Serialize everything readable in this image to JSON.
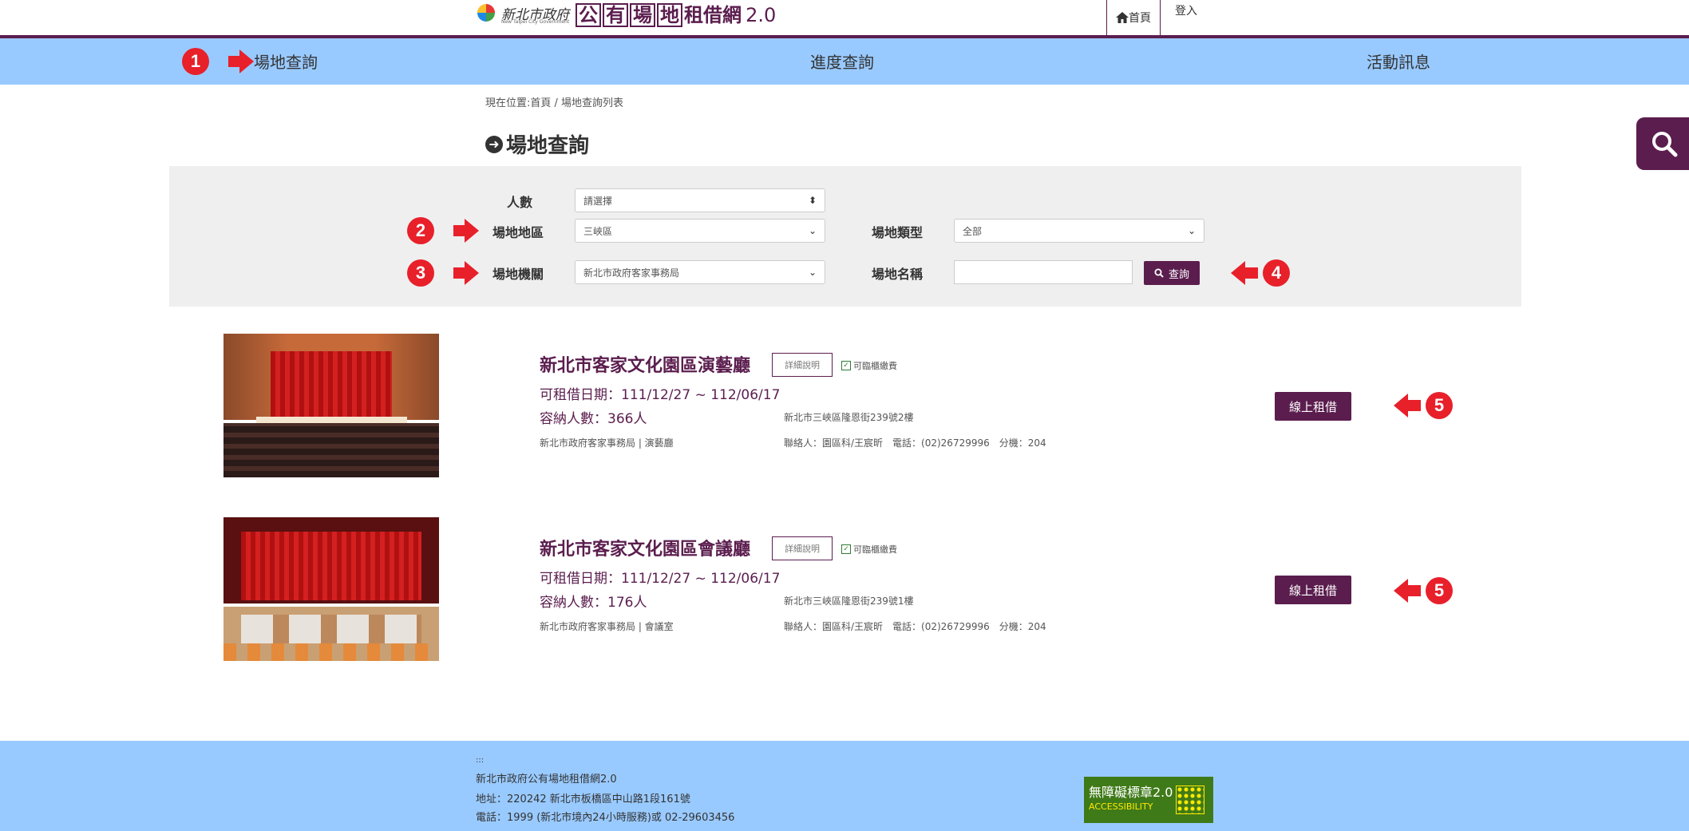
{
  "header": {
    "logo_gov": "新北市政府",
    "logo_gov_en": "New Taipei City Government",
    "logo_box_chars": [
      "公",
      "有",
      "場",
      "地"
    ],
    "logo_rest": "租借網",
    "logo_version": "2.0",
    "home_label": "首頁",
    "login_label": "登入"
  },
  "nav": {
    "items": [
      "場地查詢",
      "進度查詢",
      "活動訊息"
    ]
  },
  "breadcrumb": "現在位置:首頁 / 場地查詢列表",
  "page_title": "場地查詢",
  "search_form": {
    "people_label": "人數",
    "people_value": "請選擇",
    "area_label": "場地地區",
    "area_value": "三峽區",
    "type_label": "場地類型",
    "type_value": "全部",
    "agency_label": "場地機關",
    "agency_value": "新北市政府客家事務局",
    "name_label": "場地名稱",
    "name_value": "",
    "search_label": "查詢"
  },
  "markers": [
    "1",
    "2",
    "3",
    "4",
    "5"
  ],
  "results": [
    {
      "title": "新北市客家文化園區演藝廳",
      "detail_label": "詳細說明",
      "approve_label": "可臨櫃繳費",
      "date": "可租借日期：111/12/27 ~ 112/06/17",
      "capacity": "容納人數：366人",
      "address": "新北市三峽區隆恩街239號2樓",
      "org": "新北市政府客家事務局 | 演藝廳",
      "contact": "聯絡人：園區科/王宸昕　電話：(02)26729996　分機：204",
      "rent_label": "線上租借"
    },
    {
      "title": "新北市客家文化園區會議廳",
      "detail_label": "詳細說明",
      "approve_label": "可臨櫃繳費",
      "date": "可租借日期：111/12/27 ~ 112/06/17",
      "capacity": "容納人數：176人",
      "address": "新北市三峽區隆恩街239號1樓",
      "org": "新北市政府客家事務局 | 會議室",
      "contact": "聯絡人：園區科/王宸昕　電話：(02)26729996　分機：204",
      "rent_label": "線上租借"
    }
  ],
  "footer": {
    "accesskey": ":::",
    "site_name": "新北市政府公有場地租借網2.0",
    "address": "地址：220242 新北市板橋區中山路1段161號",
    "phone": "電話：1999 (新北市境內24小時服務)或 02-29603456",
    "badge_title": "無障礙標章2.0",
    "badge_sub": "ACCESSIBILITY"
  },
  "colors": {
    "brand": "#5b1d4e",
    "nav_bg": "#99caff",
    "marker": "#e8202a",
    "panel_bg": "#efefef"
  },
  "icons": [
    "home-icon",
    "search-icon",
    "arrow-circle-right-icon",
    "checkbox-icon",
    "accessibility-badge-icon"
  ]
}
